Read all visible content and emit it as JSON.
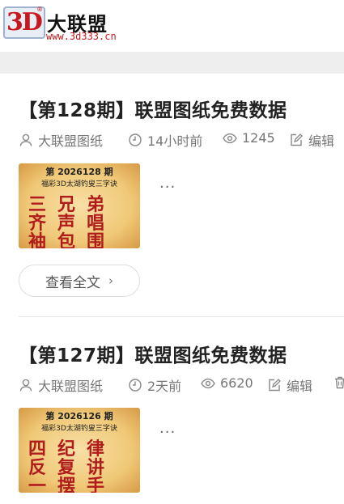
{
  "header": {
    "logo_3d": "3D",
    "logo_reg": "®",
    "logo_cn": "大联盟",
    "logo_url": "www.3d333.cn"
  },
  "posts": [
    {
      "title": "【第128期】联盟图纸免费数据",
      "author": "大联盟图纸",
      "time": "14小时前",
      "views": "1245",
      "edit": "编辑",
      "thumb": {
        "issue": "第 2026128 期",
        "subtitle": "福彩3D太湖钓叟三字诀",
        "lines": [
          "三兄弟",
          "齐声唱",
          "袖包围"
        ]
      },
      "more": "···",
      "readmore": "查看全文"
    },
    {
      "title": "【第127期】联盟图纸免费数据",
      "author": "大联盟图纸",
      "time": "2天前",
      "views": "6620",
      "edit": "编辑",
      "thumb": {
        "issue": "第 2026126 期",
        "subtitle": "福彩3D太湖钓叟三字诀",
        "lines": [
          "四纪律",
          "反复讲",
          "一摆手"
        ]
      },
      "more": "···"
    }
  ],
  "icons": {
    "user": "user-icon",
    "clock": "clock-icon",
    "eye": "eye-icon",
    "edit": "edit-icon",
    "trash": "trash-icon"
  }
}
